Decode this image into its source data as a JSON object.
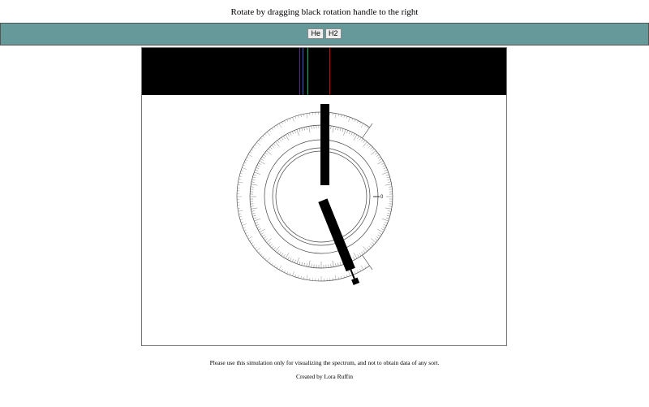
{
  "header": {
    "instruction": "Rotate by dragging black rotation handle to the right"
  },
  "toolbar": {
    "buttons": [
      {
        "label": "He"
      },
      {
        "label": "H2"
      }
    ]
  },
  "spectrum": {
    "lines": [
      {
        "color": "#5a2d8c"
      },
      {
        "color": "#3a5fd0"
      },
      {
        "color": "#00c070"
      },
      {
        "color": "#e00000"
      }
    ]
  },
  "protractor": {
    "center_mark": "0",
    "handle_angle_deg": 22
  },
  "footer": {
    "notice": "Please use this simulation only for visualizing the spectrum, and not to obtain data of any sort.",
    "credit": "Created by Lora Ruffin"
  }
}
